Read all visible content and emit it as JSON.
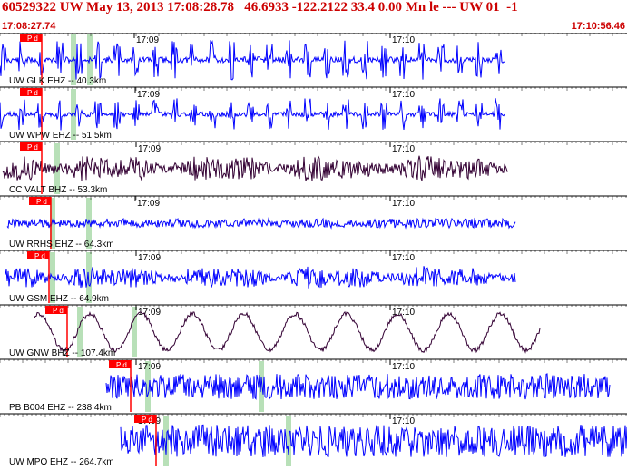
{
  "header": {
    "title": "60529322 UW May 13, 2013 17:08:28.78   46.6933 -122.2122 33.4 0.00 Mn le --- UW 01  -1",
    "start_time": "17:08:27.74",
    "end_time": "17:10:56.46"
  },
  "minute_labels": [
    "17:09",
    "17:10"
  ],
  "pick_label": "P d",
  "colors": {
    "header_text": "#cc0000",
    "trace_blue": "#0000ff",
    "trace_purple": "#330033",
    "pick_red": "#ff0000",
    "highlight_green": "#b8e0b8",
    "grid_black": "#000000"
  },
  "traces": [
    {
      "label": "UW GLK EHZ -- 40.3km",
      "color": "trace_blue",
      "style": "spiky"
    },
    {
      "label": "UW WPW EHZ -- 51.5km",
      "color": "trace_blue",
      "style": "spiky"
    },
    {
      "label": "CC VALT BHZ -- 53.3km",
      "color": "trace_purple",
      "style": "noise"
    },
    {
      "label": "UW RRHS EHZ -- 64.3km",
      "color": "trace_blue",
      "style": "quiet"
    },
    {
      "label": "UW GSM EHZ -- 64.9km",
      "color": "trace_blue",
      "style": "noise"
    },
    {
      "label": "UW GNW BHZ -- 107.4km",
      "color": "trace_purple",
      "style": "wave"
    },
    {
      "label": "PB B004 EHZ -- 238.4km",
      "color": "trace_blue",
      "style": "dense"
    },
    {
      "label": "UW MPO EHZ -- 264.7km",
      "color": "trace_blue",
      "style": "dense"
    }
  ]
}
